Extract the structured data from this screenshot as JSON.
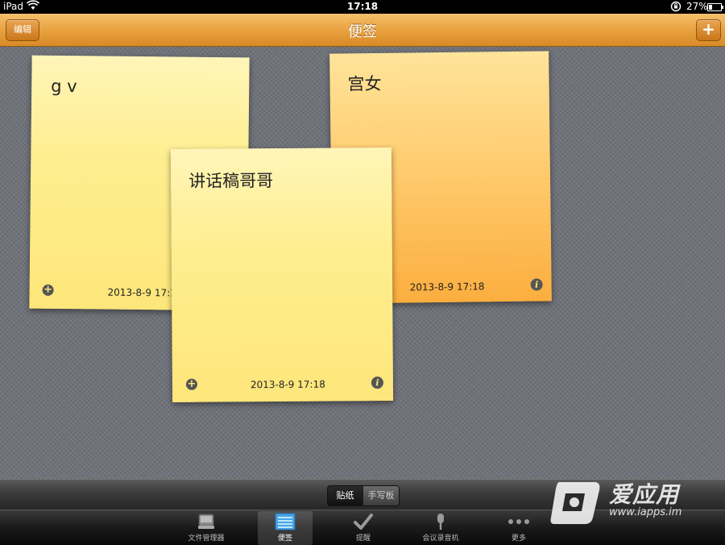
{
  "status_bar": {
    "device": "iPad",
    "time": "17:18",
    "battery": "27%",
    "battery_level": 0.27,
    "icons": [
      "wifi-icon",
      "orientation-lock-icon",
      "battery-icon"
    ]
  },
  "nav": {
    "title": "便签",
    "edit_label": "编辑",
    "add_label": "+"
  },
  "notes": [
    {
      "text": "g v",
      "date": "2013-8-9 17:18",
      "color": "#fde67a"
    },
    {
      "text": "宫女",
      "date": "2013-8-9 17:18",
      "color": "#fbae3f"
    },
    {
      "text": "讲话稿哥哥",
      "date": "2013-8-9 17:18",
      "color": "#fde67a"
    }
  ],
  "segments": {
    "items": [
      "贴纸",
      "手写板"
    ],
    "selected": "贴纸"
  },
  "tabs": [
    {
      "label": "文件管理器",
      "icon": "drive-icon",
      "active": false
    },
    {
      "label": "便签",
      "icon": "notes-icon",
      "active": true
    },
    {
      "label": "提醒",
      "icon": "checkmark-icon",
      "active": false
    },
    {
      "label": "会议录音机",
      "icon": "microphone-icon",
      "active": false
    },
    {
      "label": "更多",
      "icon": "more-icon",
      "active": false
    }
  ],
  "watermark": {
    "name": "爱应用",
    "url": "www.iapps.im"
  },
  "colors": {
    "nav_orange": "#e9a240",
    "board_gray": "#6f7279",
    "note_yellow": "#fde67a",
    "note_orange": "#fbae3f"
  }
}
